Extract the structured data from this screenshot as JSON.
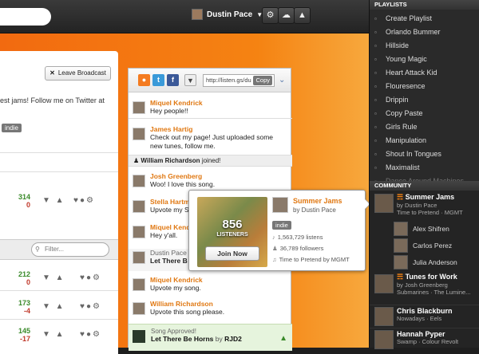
{
  "topbar": {
    "user_name": "Dustin Pace",
    "buttons": [
      "gear-icon",
      "cloud-icon",
      "lamp-icon"
    ]
  },
  "main": {
    "leave_label": "Leave Broadcast",
    "desc_line1": "est jams! Follow me on Twitter at",
    "tag": "indie",
    "filter_placeholder": "Filter...",
    "rows": [
      {
        "up": "314",
        "down": "0"
      },
      {
        "up": "212",
        "down": "0"
      },
      {
        "up": "173",
        "down": "-4"
      },
      {
        "up": "145",
        "down": "-17"
      }
    ]
  },
  "share": {
    "url": "http://listen.gs/du",
    "copy": "Copy"
  },
  "chat": {
    "messages": [
      {
        "name": "Miquel Kendrick",
        "text": "Hey people!!"
      },
      {
        "name": "James Hartig",
        "text": "Check out my page! Just uploaded some new tunes, follow me."
      },
      {
        "name": "Josh Greenberg",
        "text": "Woo! I love this song."
      },
      {
        "name": "Stella Hartma",
        "text": "Upvote my S"
      },
      {
        "name": "Miquel Kendri",
        "text": "Hey y'all."
      },
      {
        "name": "Dustin Pace s",
        "text": "Let There B"
      },
      {
        "name": "Miquel Kendrick",
        "text": "Upvote my song."
      },
      {
        "name": "William Richardson",
        "text": "Upvote this song please."
      }
    ],
    "system_name": "William Richardson",
    "system_text": "joined!",
    "song_label": "Song Approved!",
    "song_title": "Let There Be Horns",
    "song_by": "by",
    "song_artist": "RJD2"
  },
  "popup": {
    "listeners": "856",
    "listeners_label": "LISTENERS",
    "join": "Join Now",
    "title": "Summer Jams",
    "by": "by Dustin Pace",
    "tag": "indie",
    "listens": "1,563,729 listens",
    "followers": "36,789 followers",
    "now": "Time to Pretend by MGMT"
  },
  "sidebar": {
    "playlists_head": "PLAYLISTS",
    "playlists": [
      "Create Playlist",
      "Orlando Bummer",
      "Hillside",
      "Young Magic",
      "Heart Attack Kid",
      "Flouresence",
      "Drippin",
      "Copy Paste",
      "Girls Rule",
      "Manipulation",
      "Shout In Tongues",
      "Maximalist",
      "Dance Around Machines"
    ],
    "community_head": "COMMUNITY",
    "community": {
      "b1_title": "Summer Jams",
      "b1_by": "by Dustin Pace",
      "b1_now": "Time to Pretend · MGMT",
      "members": [
        "Alex Shifren",
        "Carlos Perez",
        "Julia Anderson"
      ],
      "b2_title": "Tunes for Work",
      "b2_by": "by Josh Greenberg",
      "b2_now": "Submarines · The Lumine...",
      "u1_name": "Chris Blackburn",
      "u1_now": "Nowadays · Eels",
      "u2_name": "Hannah Pyper",
      "u2_now": "Swamp · Colour Revolt"
    }
  }
}
